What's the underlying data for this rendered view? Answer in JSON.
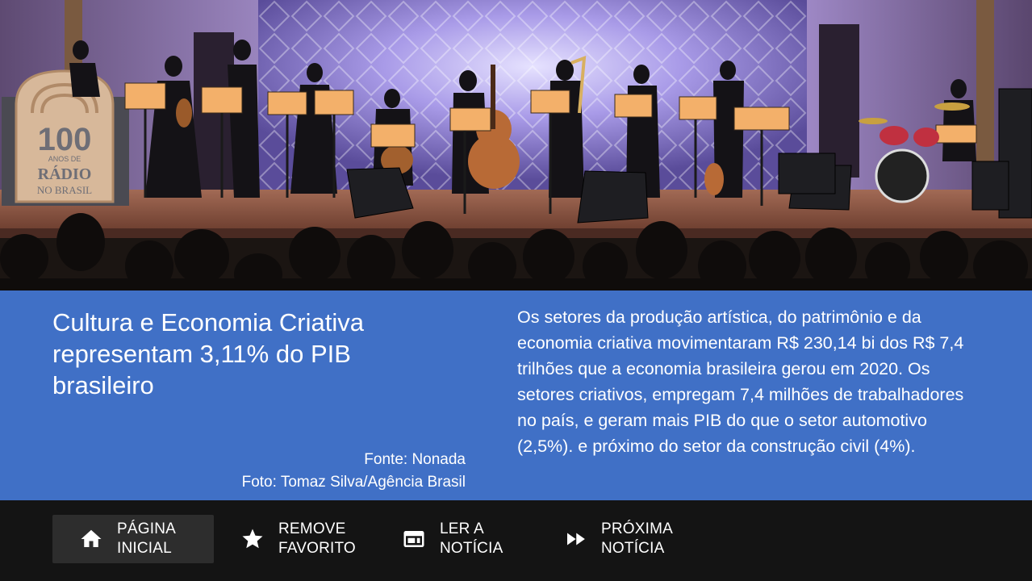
{
  "hero": {
    "sign_number": "100",
    "sign_line1": "ANOS DE",
    "sign_line2": "RÁDIO",
    "sign_line3": "NO BRASIL"
  },
  "article": {
    "headline": "Cultura e Economia Criativa representam 3,11% do PIB brasileiro",
    "source": "Fonte: Nonada",
    "photo_credit": "Foto: Tomaz Silva/Agência Brasil",
    "summary": "Os setores da produção artística, do patrimônio e da economia criativa movimentaram R$ 230,14 bi dos R$ 7,4 trilhões que a economia brasileira gerou em 2020. Os setores criativos, empregam 7,4 milhões de trabalhadores no país, e geram mais PIB do que o setor automotivo (2,5%). e próximo do setor da construção civil (4%)."
  },
  "nav": {
    "home": {
      "label_1": "PÁGINA",
      "label_2": "INICIAL",
      "icon": "home-icon"
    },
    "favorite": {
      "label_1": "REMOVE",
      "label_2": "FAVORITO",
      "icon": "star-icon"
    },
    "read": {
      "label_1": "LER A",
      "label_2": "NOTÍCIA",
      "icon": "article-icon"
    },
    "next": {
      "label_1": "PRÓXIMA",
      "label_2": "NOTÍCIA",
      "icon": "fast-forward-icon"
    }
  },
  "colors": {
    "panel": "#4070c6",
    "bar": "#141414",
    "focused_button": "#2d2d2d"
  }
}
